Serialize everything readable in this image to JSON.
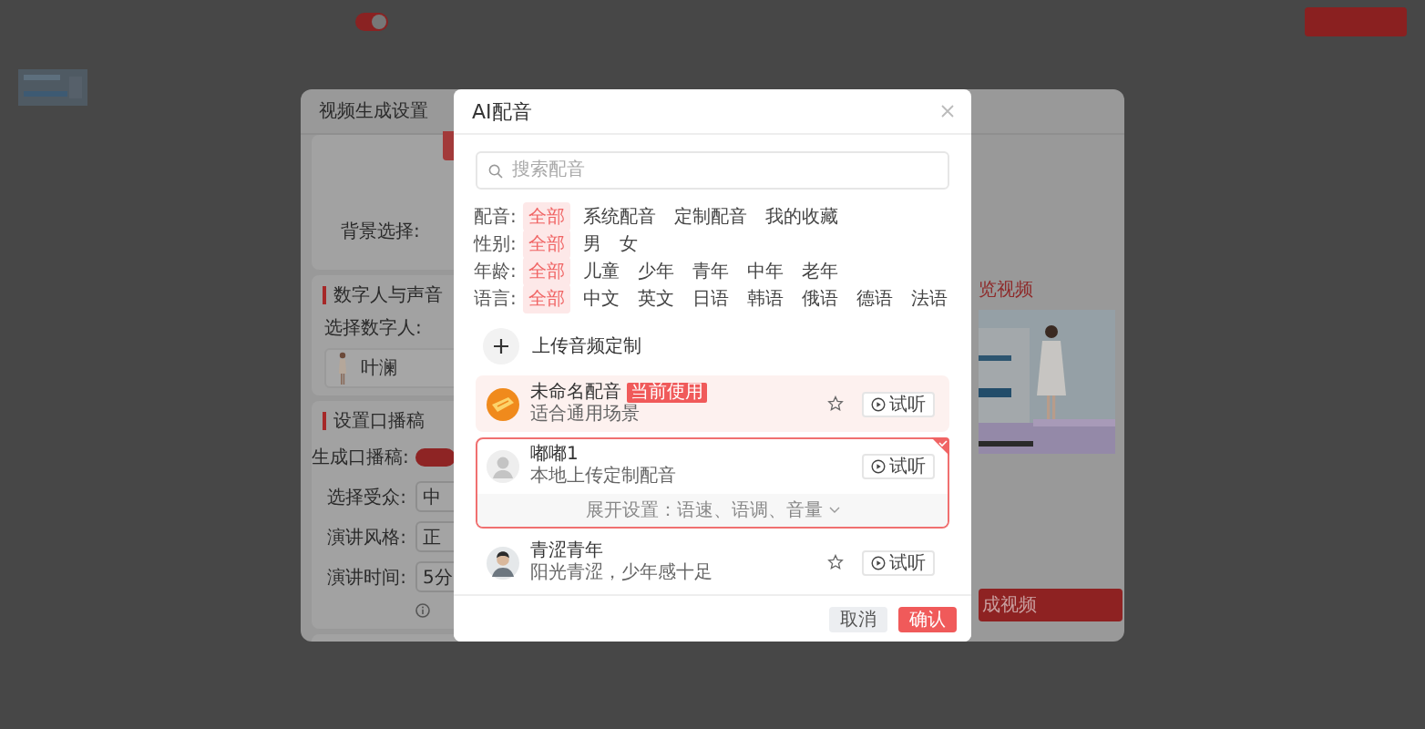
{
  "top_bar": {
    "toggle_on": true
  },
  "settings_dialog": {
    "title": "视频生成设置",
    "background_label": "背景选择:",
    "avatar_section": {
      "title": "数字人与声音",
      "label": "选择数字人:",
      "avatar_name": "叶澜"
    },
    "script_section": {
      "title": "设置口播稿",
      "rows": [
        {
          "kind": "toggle",
          "label": "生成口播稿:",
          "on": true
        },
        {
          "kind": "select",
          "label": "选择受众:",
          "value": "中"
        },
        {
          "kind": "select",
          "label": "演讲风格:",
          "value": "正"
        },
        {
          "kind": "select",
          "label": "演讲时间:",
          "value": "5分"
        },
        {
          "kind": "note"
        }
      ]
    },
    "preview": {
      "title": "览视频",
      "button": "成视频"
    }
  },
  "voice_dialog": {
    "title": "AI配音",
    "search": {
      "placeholder": "搜索配音"
    },
    "filters": [
      {
        "label": "配音:",
        "options": [
          {
            "label": "全部",
            "selected": true
          },
          {
            "label": "系统配音",
            "selected": false
          },
          {
            "label": "定制配音",
            "selected": false
          },
          {
            "label": "我的收藏",
            "selected": false
          }
        ]
      },
      {
        "label": "性别:",
        "options": [
          {
            "label": "全部",
            "selected": true
          },
          {
            "label": "男",
            "selected": false
          },
          {
            "label": "女",
            "selected": false
          }
        ]
      },
      {
        "label": "年龄:",
        "options": [
          {
            "label": "全部",
            "selected": true
          },
          {
            "label": "儿童",
            "selected": false
          },
          {
            "label": "少年",
            "selected": false
          },
          {
            "label": "青年",
            "selected": false
          },
          {
            "label": "中年",
            "selected": false
          },
          {
            "label": "老年",
            "selected": false
          }
        ]
      },
      {
        "label": "语言:",
        "options": [
          {
            "label": "全部",
            "selected": true
          },
          {
            "label": "中文",
            "selected": false
          },
          {
            "label": "英文",
            "selected": false
          },
          {
            "label": "日语",
            "selected": false
          },
          {
            "label": "韩语",
            "selected": false
          },
          {
            "label": "俄语",
            "selected": false
          },
          {
            "label": "德语",
            "selected": false
          },
          {
            "label": "法语",
            "selected": false
          }
        ]
      }
    ],
    "upload": "上传音频定制",
    "voices": [
      {
        "avatar": {
          "kind": "logo"
        },
        "name": "未命名配音",
        "badge": "当前使用",
        "description": "适合通用场景",
        "current": true,
        "selected": false,
        "favorite": false,
        "play": "试听"
      },
      {
        "avatar": {
          "kind": "placeholder"
        },
        "name": "嘟嘟1",
        "description": "本地上传定制配音",
        "current": false,
        "selected": true,
        "play": "试听",
        "settings_hint": "展开设置：语速、语调、音量"
      },
      {
        "avatar": {
          "kind": "person"
        },
        "name": "青涩青年",
        "description": "阳光青涩，少年感十足",
        "current": false,
        "selected": false,
        "favorite": false,
        "play": "试听"
      }
    ],
    "cancel": "取消",
    "confirm": "确认"
  }
}
